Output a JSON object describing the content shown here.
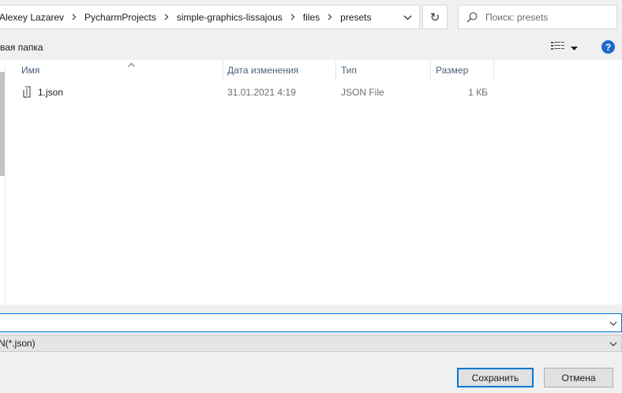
{
  "breadcrumb": [
    "Alexey Lazarev",
    "PycharmProjects",
    "simple-graphics-lissajous",
    "files",
    "presets"
  ],
  "search": {
    "placeholder": "Поиск: presets"
  },
  "toolbar": {
    "new_folder": "вая папка"
  },
  "columns": {
    "name": "Имя",
    "date": "Дата изменения",
    "type": "Тип",
    "size": "Размер"
  },
  "files": [
    {
      "name": "1.json",
      "date": "31.01.2021 4:19",
      "type": "JSON File",
      "size": "1 КБ",
      "icon": "json-file-icon"
    }
  ],
  "file_name": {
    "value": ""
  },
  "file_type": {
    "value": "N(*.json)"
  },
  "buttons": {
    "save": "Сохранить",
    "cancel": "Отмена"
  },
  "colors": {
    "accent": "#0078d7",
    "help": "#1b6ac9"
  }
}
